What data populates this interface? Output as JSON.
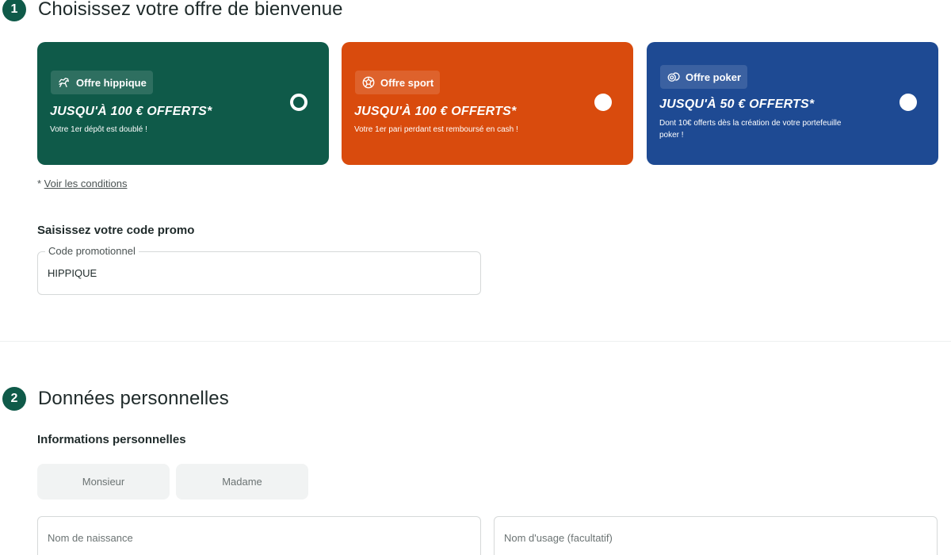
{
  "step1": {
    "number": "1",
    "title": "Choisissez votre offre de bienvenue"
  },
  "offers": [
    {
      "tag": "Offre hippique",
      "icon": "horse-icon",
      "amount": "JUSQU'À 100 € OFFERTS*",
      "description": "Votre 1er dépôt est doublé !",
      "color": "#0f5a49",
      "selected": true
    },
    {
      "tag": "Offre sport",
      "icon": "soccer-ball-icon",
      "amount": "JUSQU'À 100 € OFFERTS*",
      "description": "Votre 1er pari perdant est remboursé en cash !",
      "color": "#d94b0d",
      "selected": false
    },
    {
      "tag": "Offre poker",
      "icon": "poker-chips-icon",
      "amount": "JUSQU'À 50 € OFFERTS*",
      "description": "Dont 10€ offerts dès la création de votre portefeuille poker !",
      "color": "#1e4a93",
      "selected": false
    }
  ],
  "conditions": {
    "prefix": "* ",
    "link": "Voir les conditions"
  },
  "promo": {
    "title": "Saisissez votre code promo",
    "label": "Code promotionnel",
    "value": "HIPPIQUE"
  },
  "step2": {
    "number": "2",
    "title": "Données personnelles"
  },
  "personal": {
    "subtitle": "Informations personnelles",
    "civility": [
      "Monsieur",
      "Madame"
    ],
    "birth_name_placeholder": "Nom de naissance",
    "usage_name_placeholder": "Nom d'usage (facultatif)"
  }
}
